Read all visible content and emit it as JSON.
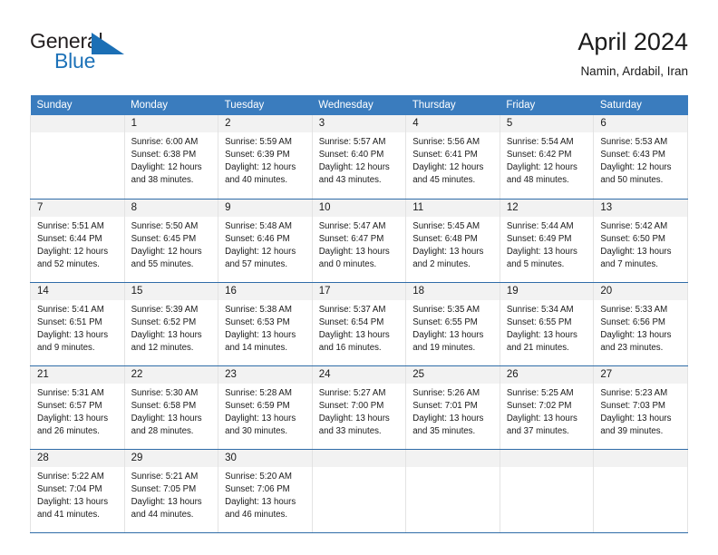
{
  "logo": {
    "word1": "General",
    "word2": "Blue",
    "triangle_color": "#1b6fb5",
    "blue_color": "#1d72b8"
  },
  "header": {
    "title": "April 2024",
    "subtitle": "Namin, Ardabil, Iran"
  },
  "theme": {
    "header_bg": "#3a7cbe",
    "daynum_bg": "#f2f2f2",
    "row_border": "#2f6ca8",
    "cell_border": "#e3e3e3",
    "text": "#1a1a1a"
  },
  "calendar": {
    "weekday_headers": [
      "Sunday",
      "Monday",
      "Tuesday",
      "Wednesday",
      "Thursday",
      "Friday",
      "Saturday"
    ],
    "weeks": [
      [
        {
          "day": "",
          "lines": []
        },
        {
          "day": "1",
          "lines": [
            "Sunrise: 6:00 AM",
            "Sunset: 6:38 PM",
            "Daylight: 12 hours",
            "and 38 minutes."
          ]
        },
        {
          "day": "2",
          "lines": [
            "Sunrise: 5:59 AM",
            "Sunset: 6:39 PM",
            "Daylight: 12 hours",
            "and 40 minutes."
          ]
        },
        {
          "day": "3",
          "lines": [
            "Sunrise: 5:57 AM",
            "Sunset: 6:40 PM",
            "Daylight: 12 hours",
            "and 43 minutes."
          ]
        },
        {
          "day": "4",
          "lines": [
            "Sunrise: 5:56 AM",
            "Sunset: 6:41 PM",
            "Daylight: 12 hours",
            "and 45 minutes."
          ]
        },
        {
          "day": "5",
          "lines": [
            "Sunrise: 5:54 AM",
            "Sunset: 6:42 PM",
            "Daylight: 12 hours",
            "and 48 minutes."
          ]
        },
        {
          "day": "6",
          "lines": [
            "Sunrise: 5:53 AM",
            "Sunset: 6:43 PM",
            "Daylight: 12 hours",
            "and 50 minutes."
          ]
        }
      ],
      [
        {
          "day": "7",
          "lines": [
            "Sunrise: 5:51 AM",
            "Sunset: 6:44 PM",
            "Daylight: 12 hours",
            "and 52 minutes."
          ]
        },
        {
          "day": "8",
          "lines": [
            "Sunrise: 5:50 AM",
            "Sunset: 6:45 PM",
            "Daylight: 12 hours",
            "and 55 minutes."
          ]
        },
        {
          "day": "9",
          "lines": [
            "Sunrise: 5:48 AM",
            "Sunset: 6:46 PM",
            "Daylight: 12 hours",
            "and 57 minutes."
          ]
        },
        {
          "day": "10",
          "lines": [
            "Sunrise: 5:47 AM",
            "Sunset: 6:47 PM",
            "Daylight: 13 hours",
            "and 0 minutes."
          ]
        },
        {
          "day": "11",
          "lines": [
            "Sunrise: 5:45 AM",
            "Sunset: 6:48 PM",
            "Daylight: 13 hours",
            "and 2 minutes."
          ]
        },
        {
          "day": "12",
          "lines": [
            "Sunrise: 5:44 AM",
            "Sunset: 6:49 PM",
            "Daylight: 13 hours",
            "and 5 minutes."
          ]
        },
        {
          "day": "13",
          "lines": [
            "Sunrise: 5:42 AM",
            "Sunset: 6:50 PM",
            "Daylight: 13 hours",
            "and 7 minutes."
          ]
        }
      ],
      [
        {
          "day": "14",
          "lines": [
            "Sunrise: 5:41 AM",
            "Sunset: 6:51 PM",
            "Daylight: 13 hours",
            "and 9 minutes."
          ]
        },
        {
          "day": "15",
          "lines": [
            "Sunrise: 5:39 AM",
            "Sunset: 6:52 PM",
            "Daylight: 13 hours",
            "and 12 minutes."
          ]
        },
        {
          "day": "16",
          "lines": [
            "Sunrise: 5:38 AM",
            "Sunset: 6:53 PM",
            "Daylight: 13 hours",
            "and 14 minutes."
          ]
        },
        {
          "day": "17",
          "lines": [
            "Sunrise: 5:37 AM",
            "Sunset: 6:54 PM",
            "Daylight: 13 hours",
            "and 16 minutes."
          ]
        },
        {
          "day": "18",
          "lines": [
            "Sunrise: 5:35 AM",
            "Sunset: 6:55 PM",
            "Daylight: 13 hours",
            "and 19 minutes."
          ]
        },
        {
          "day": "19",
          "lines": [
            "Sunrise: 5:34 AM",
            "Sunset: 6:55 PM",
            "Daylight: 13 hours",
            "and 21 minutes."
          ]
        },
        {
          "day": "20",
          "lines": [
            "Sunrise: 5:33 AM",
            "Sunset: 6:56 PM",
            "Daylight: 13 hours",
            "and 23 minutes."
          ]
        }
      ],
      [
        {
          "day": "21",
          "lines": [
            "Sunrise: 5:31 AM",
            "Sunset: 6:57 PM",
            "Daylight: 13 hours",
            "and 26 minutes."
          ]
        },
        {
          "day": "22",
          "lines": [
            "Sunrise: 5:30 AM",
            "Sunset: 6:58 PM",
            "Daylight: 13 hours",
            "and 28 minutes."
          ]
        },
        {
          "day": "23",
          "lines": [
            "Sunrise: 5:28 AM",
            "Sunset: 6:59 PM",
            "Daylight: 13 hours",
            "and 30 minutes."
          ]
        },
        {
          "day": "24",
          "lines": [
            "Sunrise: 5:27 AM",
            "Sunset: 7:00 PM",
            "Daylight: 13 hours",
            "and 33 minutes."
          ]
        },
        {
          "day": "25",
          "lines": [
            "Sunrise: 5:26 AM",
            "Sunset: 7:01 PM",
            "Daylight: 13 hours",
            "and 35 minutes."
          ]
        },
        {
          "day": "26",
          "lines": [
            "Sunrise: 5:25 AM",
            "Sunset: 7:02 PM",
            "Daylight: 13 hours",
            "and 37 minutes."
          ]
        },
        {
          "day": "27",
          "lines": [
            "Sunrise: 5:23 AM",
            "Sunset: 7:03 PM",
            "Daylight: 13 hours",
            "and 39 minutes."
          ]
        }
      ],
      [
        {
          "day": "28",
          "lines": [
            "Sunrise: 5:22 AM",
            "Sunset: 7:04 PM",
            "Daylight: 13 hours",
            "and 41 minutes."
          ]
        },
        {
          "day": "29",
          "lines": [
            "Sunrise: 5:21 AM",
            "Sunset: 7:05 PM",
            "Daylight: 13 hours",
            "and 44 minutes."
          ]
        },
        {
          "day": "30",
          "lines": [
            "Sunrise: 5:20 AM",
            "Sunset: 7:06 PM",
            "Daylight: 13 hours",
            "and 46 minutes."
          ]
        },
        {
          "day": "",
          "lines": []
        },
        {
          "day": "",
          "lines": []
        },
        {
          "day": "",
          "lines": []
        },
        {
          "day": "",
          "lines": []
        }
      ]
    ]
  }
}
